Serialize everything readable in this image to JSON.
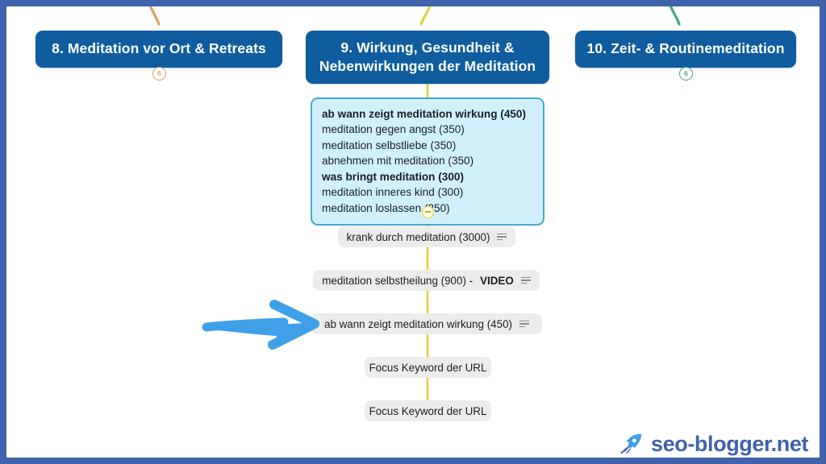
{
  "frame": {
    "border_color": "#3f62ab",
    "background": "#ffffff"
  },
  "mindmap": {
    "topics": [
      {
        "id": "topic-8",
        "label": "8. Meditation vor Ort & Retreats",
        "color": "#0f5c9e",
        "connector_color": "#d9a066",
        "badge_count": "6"
      },
      {
        "id": "topic-9",
        "label_line1": "9. Wirkung, Gesundheit &",
        "label_line2": "Nebenwirkungen der Meditation",
        "color": "#0f5c9e",
        "connector_color": "#e0d23f"
      },
      {
        "id": "topic-10",
        "label": "10. Zeit- & Routinemeditation",
        "color": "#0f5c9e",
        "connector_color": "#3fa877",
        "badge_count": "6"
      }
    ],
    "keyword_box": {
      "fill": "#d2f0fb",
      "border": "#46a8d6",
      "lines": [
        {
          "text": "ab wann zeigt meditation wirkung (450)",
          "bold": true
        },
        {
          "text": "meditation gegen angst (350)",
          "bold": false
        },
        {
          "text": "meditation selbstliebe (350)",
          "bold": false
        },
        {
          "text": "abnehmen mit meditation (350)",
          "bold": false
        },
        {
          "text": "was bringt meditation (300)",
          "bold": true
        },
        {
          "text": "meditation inneres kind (300)",
          "bold": false
        },
        {
          "text": "meditation loslassen (250)",
          "bold": false
        }
      ]
    },
    "chips": [
      {
        "id": "chip-1",
        "text": "krank durch meditation (3000)",
        "bold_suffix": "",
        "has_note_icon": true
      },
      {
        "id": "chip-2",
        "text": "meditation selbstheilung (900) - ",
        "bold_suffix": "VIDEO",
        "has_note_icon": true
      },
      {
        "id": "chip-3",
        "text": "ab wann zeigt meditation wirkung (450)",
        "bold_suffix": "",
        "has_note_icon": true
      },
      {
        "id": "chip-4",
        "text": "Focus Keyword der URL",
        "bold_suffix": "",
        "has_note_icon": false
      },
      {
        "id": "chip-5",
        "text": "Focus Keyword der URL",
        "bold_suffix": "",
        "has_note_icon": false
      }
    ],
    "annotation_arrow": {
      "color": "#3fa0e8",
      "direction": "right",
      "points_at": "chip-3"
    }
  },
  "logo": {
    "text": "seo-blogger.net",
    "color": "#3f62ab",
    "icon": "rocket-icon"
  }
}
